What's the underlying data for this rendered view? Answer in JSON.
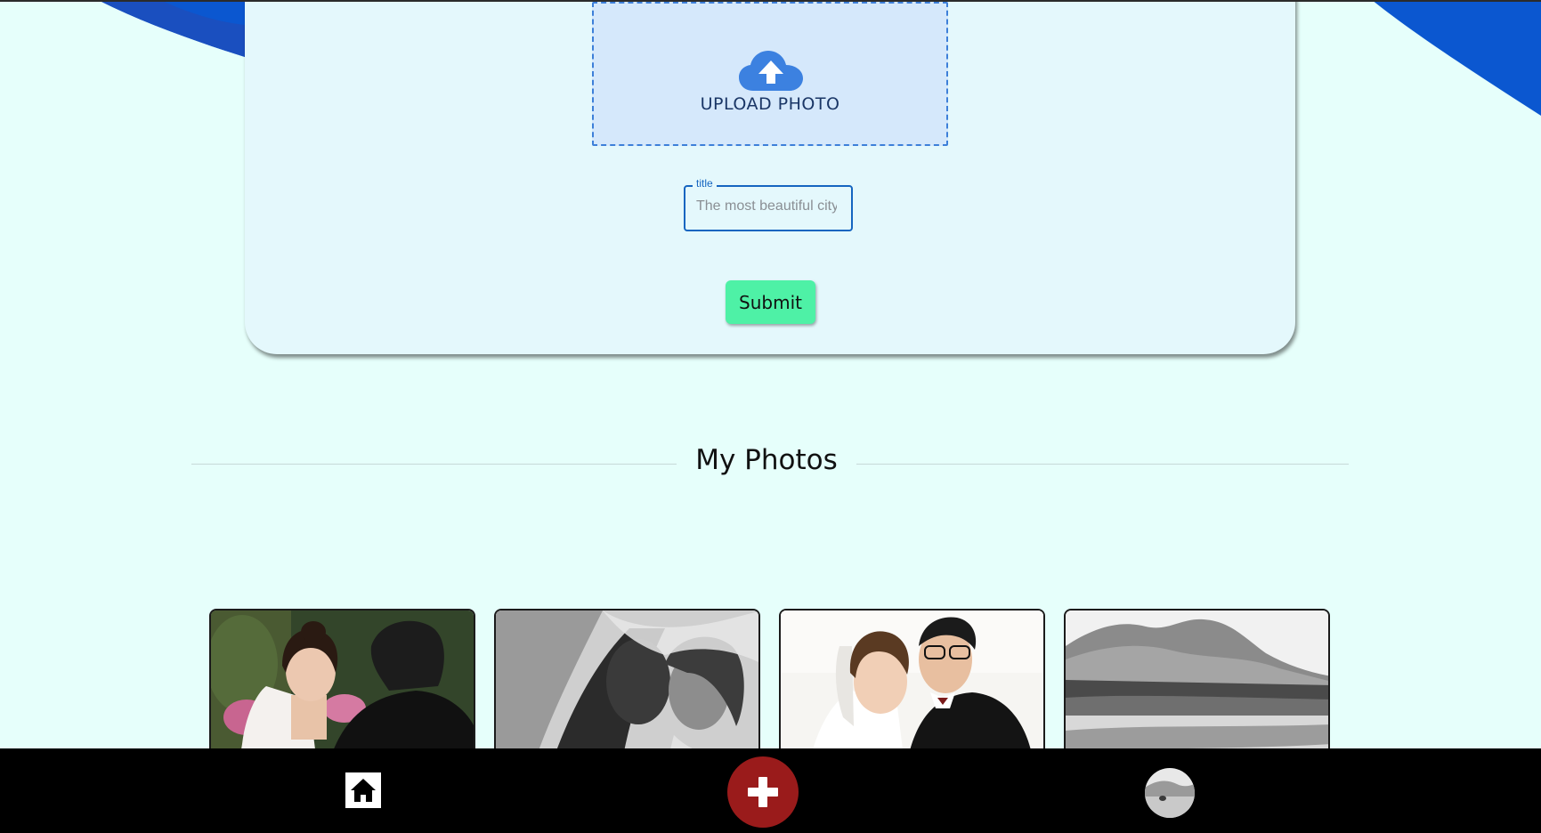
{
  "upload_form": {
    "dropzone_label": "UPLOAD PHOTO",
    "title_field": {
      "legend": "title",
      "placeholder": "The most beautiful city",
      "value": ""
    },
    "submit_label": "Submit"
  },
  "gallery": {
    "heading": "My Photos",
    "photos": [
      {
        "alt": "Bride smiling at groom",
        "style": "color"
      },
      {
        "alt": "Couple under veil",
        "style": "grayscale"
      },
      {
        "alt": "Couple smiling together",
        "style": "color"
      },
      {
        "alt": "Mountain landscape",
        "style": "grayscale"
      }
    ]
  },
  "bottom_nav": {
    "items": [
      {
        "name": "home",
        "icon": "home-icon"
      },
      {
        "name": "add",
        "icon": "plus-icon"
      },
      {
        "name": "profile",
        "icon": "avatar"
      }
    ]
  },
  "colors": {
    "background": "#e6fffb",
    "accent_blue": "#0b57d0",
    "submit_green": "#4ef1a6",
    "add_button_red": "#9a1b1b",
    "nav_bar": "#000000"
  }
}
